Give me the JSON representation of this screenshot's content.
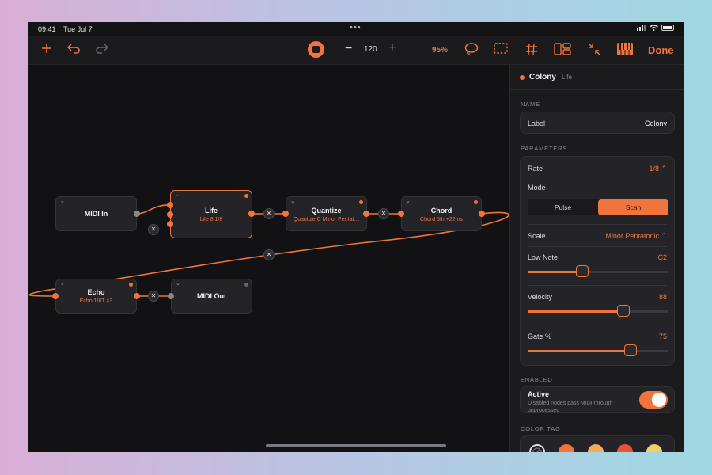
{
  "status_bar": {
    "time": "09:41",
    "date": "Tue Jul 7",
    "handle_dots": "•••"
  },
  "toolbar": {
    "add_icon": "plus-icon",
    "undo_icon": "undo-icon",
    "redo_icon": "redo-icon",
    "transport_icon": "stop-icon",
    "tempo_minus": "−",
    "tempo": "120",
    "tempo_plus": "+",
    "zoom": "95%",
    "done_label": "Done",
    "accent_color": "#f0743b"
  },
  "nodes": [
    {
      "id": "midi-in",
      "title": "MIDI In",
      "subtitle": ""
    },
    {
      "id": "life",
      "title": "Life",
      "subtitle": "Life 8 1/8"
    },
    {
      "id": "quantize",
      "title": "Quantize",
      "subtitle": "Quantize C Minor Pentat…"
    },
    {
      "id": "chord",
      "title": "Chord",
      "subtitle": "Chord 5th +22ms"
    },
    {
      "id": "echo",
      "title": "Echo",
      "subtitle": "Echo 1/8T ×3"
    },
    {
      "id": "midi-out",
      "title": "MIDI Out",
      "subtitle": ""
    }
  ],
  "wire_delete_glyph": "✕",
  "panel": {
    "node_name": "Colony",
    "node_type": "Life",
    "name_section": "NAME",
    "label_label": "Label",
    "label_value": "Colony",
    "parameters_section": "PARAMETERS",
    "rate_label": "Rate",
    "rate_value": "1/8 ⌃",
    "mode_label": "Mode",
    "mode_options": [
      "Pulse",
      "Scan"
    ],
    "mode_selected": "Scan",
    "scale_label": "Scale",
    "scale_value": "Minor Pentatonic ⌃",
    "low_note_label": "Low Note",
    "low_note_value": "C2",
    "low_note_level": 0.39,
    "velocity_label": "Velocity",
    "velocity_value": "88",
    "velocity_level": 0.68,
    "gate_label": "Gate %",
    "gate_value": "75",
    "gate_level": 0.73,
    "enabled_section": "ENABLED",
    "active_label": "Active",
    "active_help": "Disabled nodes pass MIDI through unprocessed",
    "active_on": true,
    "color_section": "COLOR TAG",
    "color_swatches": [
      "#f0743b",
      "#f5a95a",
      "#e8513a",
      "#f0cf6a"
    ]
  }
}
